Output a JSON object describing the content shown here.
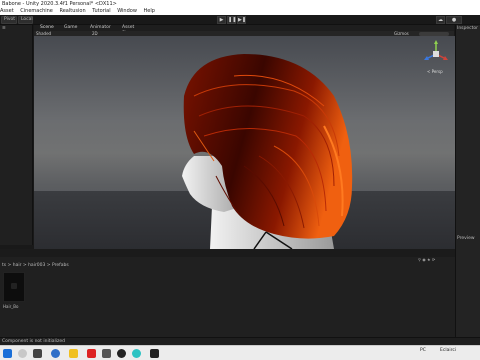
{
  "window": {
    "title": "Babone - Unity 2020.3.4f1 Personal* <DX11>"
  },
  "menu": [
    "Asset",
    "Cinemachine",
    "Realtusion",
    "Tutorial",
    "Window",
    "Help"
  ],
  "toolbar": {
    "pivot_label": "Pivot",
    "local_label": "Local",
    "play_icons": [
      "play-icon",
      "pause-icon",
      "step-icon"
    ]
  },
  "scene_tabs": [
    {
      "label": "Scene"
    },
    {
      "label": "Game"
    },
    {
      "label": "Animator"
    },
    {
      "label": "Asset Store"
    }
  ],
  "scene_bar": {
    "shading_label": "Shaded",
    "gizmos_label": "Gizmos",
    "mode_label": "2D"
  },
  "gizmo": {
    "persp_label": "< Persp"
  },
  "right_panel": {
    "inspector_label": "Inspector",
    "preview_label": "Preview"
  },
  "bottom_panel": {
    "path": "ts > hair > hair003 > Prefabs",
    "prefab_name": "Hair_Bo"
  },
  "status": {
    "message": "Component is not initialized"
  },
  "taskbar": {
    "user_label": "PC",
    "locale_label": "Eclairci"
  },
  "colors": {
    "hair_dark": "#3a0600",
    "hair_mid": "#8a1500",
    "hair_bright": "#f06010",
    "skin": "#d8d8d8",
    "scene_bg": "#5b5d62"
  }
}
